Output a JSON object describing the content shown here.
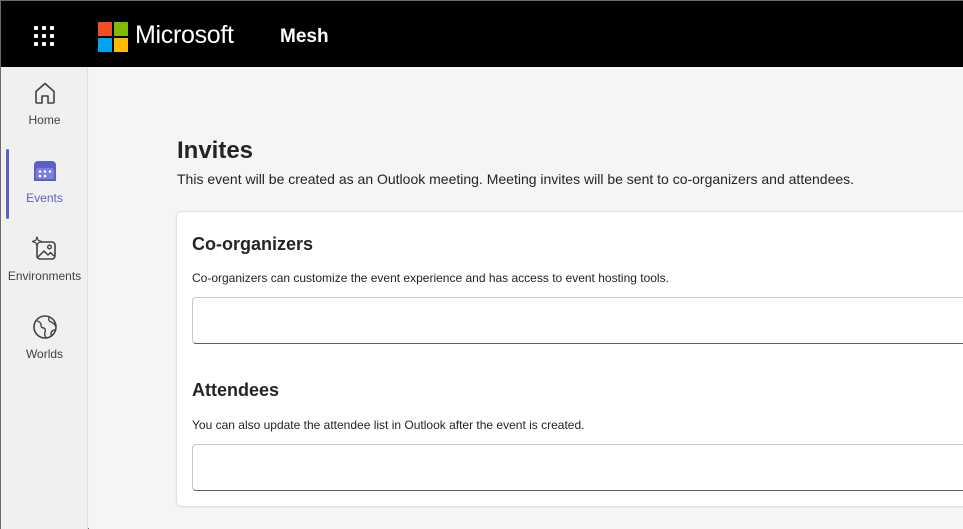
{
  "topbar": {
    "brand": "Microsoft",
    "app_name": "Mesh",
    "logo_colors": [
      "#f25022",
      "#7fba00",
      "#00a4ef",
      "#ffb900"
    ]
  },
  "sidebar": {
    "active_color": "#5b5fc7",
    "items": [
      {
        "label": "Home",
        "icon": "home-icon"
      },
      {
        "label": "Events",
        "icon": "calendar-icon",
        "active": true
      },
      {
        "label": "Environments",
        "icon": "image-sparkle-icon"
      },
      {
        "label": "Worlds",
        "icon": "globe-icon"
      }
    ]
  },
  "page": {
    "title": "Invites",
    "description": "This event will be created as an Outlook meeting. Meeting invites will be sent to co-organizers and attendees."
  },
  "co_organizers": {
    "title": "Co-organizers",
    "description": "Co-organizers can customize the event experience and has access to event hosting tools.",
    "value": "",
    "placeholder": ""
  },
  "attendees": {
    "title": "Attendees",
    "description": "You can also update the attendee list in Outlook after the event is created.",
    "value": "",
    "placeholder": ""
  }
}
